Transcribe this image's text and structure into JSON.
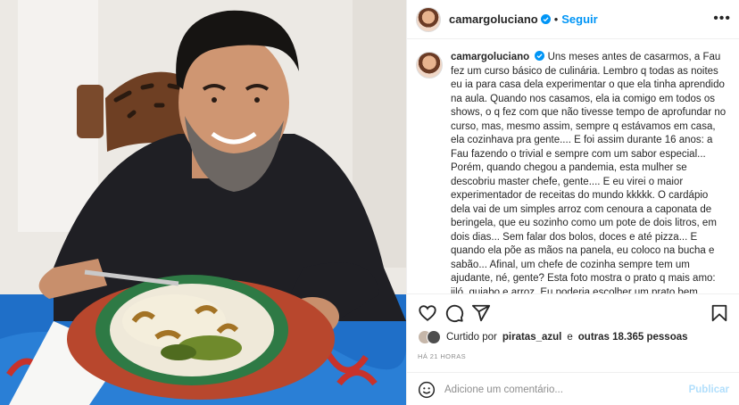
{
  "post": {
    "image_alt_name": "post-photo",
    "author": "camargoluciano",
    "follow_label": "Seguir",
    "separator": "•",
    "more_label": "•••",
    "caption": "Uns meses antes de casarmos, a Fau fez um curso básico de culinária. Lembro q todas as noites eu ia para casa dela experimentar o que ela tinha aprendido na aula. Quando nos casamos, ela ia comigo em todos os shows, o q fez com que não tivesse tempo de aprofundar no curso, mas, mesmo assim, sempre q estávamos em casa, ela cozinhava pra gente.... E foi assim durante 16 anos: a Fau fazendo o trivial e sempre com um sabor especial... Porém, quando chegou a pandemia, esta mulher se descobriu master chefe, gente.... E eu virei o maior experimentador de receitas do mundo kkkkk. O cardápio dela vai de um simples arroz com cenoura a caponata de beringela, que eu sozinho como um pote de dois litros, em dois dias... Sem falar dos bolos, doces e até pizza... E quando ela põe as mãos na panela, eu coloco na bucha e sabão... Afinal, um chefe de cozinha sempre tem um ajudante, né, gente? Esta foto mostra o prato q mais amo: jiló, quiabo e arroz. Eu poderia escolher um prato bem elaborado para fazer este post, mas fazer o simples é muito mais difícil... Vi, obrigado por ser esta mulher maravilhosa, incrível ... Vc é o sal e o doce em minha vida, sou grato a Deus por ter me escolhido para ser o seu marido. Te amo!! Ah, oq vc vai fazer amanhã no almoço? É que eu acabei"
  },
  "engagement": {
    "liked_by_prefix": "Curtido por",
    "liked_by_user": "piratas_azul",
    "liked_by_connector": "e",
    "liked_by_others": "outras 18.365 pessoas",
    "time_ago": "HÁ 21 HORAS"
  },
  "comment": {
    "placeholder": "Adicione um comentário...",
    "publish_label": "Publicar"
  },
  "colors": {
    "accent": "#0095f6",
    "publish_disabled": "#b2dffc",
    "muted": "#8e8e8e"
  },
  "icons": [
    "heart-icon",
    "comment-icon",
    "share-icon",
    "bookmark-icon",
    "emoji-icon",
    "verified-icon",
    "more-icon"
  ]
}
